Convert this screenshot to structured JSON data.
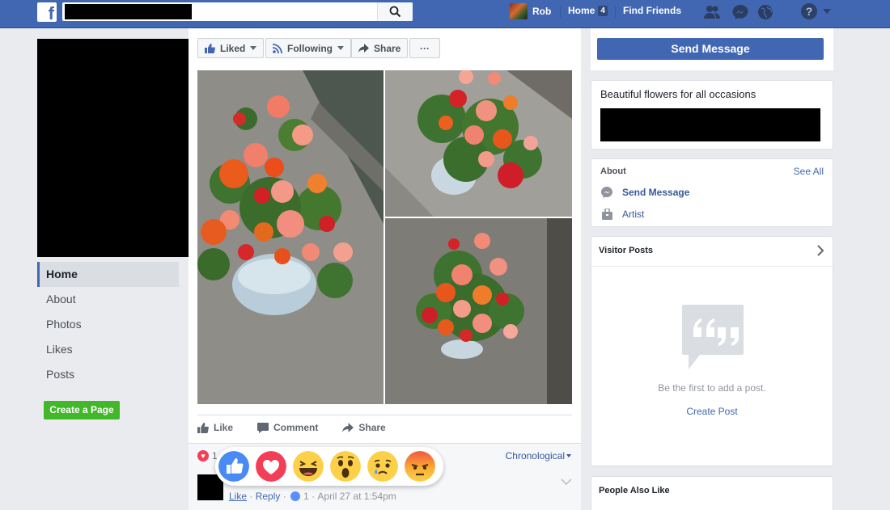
{
  "topbar": {
    "logo": "f",
    "search_placeholder": "",
    "user_name": "Rob",
    "home_label": "Home",
    "home_badge": "4",
    "find_friends_label": "Find Friends",
    "help_label": "?",
    "icons": [
      "friend-requests-icon",
      "messenger-icon",
      "notifications-globe-icon",
      "help-icon",
      "account-menu-caret-icon"
    ]
  },
  "left_nav": {
    "items": [
      {
        "label": "Home",
        "active": true
      },
      {
        "label": "About"
      },
      {
        "label": "Photos"
      },
      {
        "label": "Likes"
      },
      {
        "label": "Posts"
      }
    ],
    "create_page_label": "Create a Page"
  },
  "page_actions": {
    "liked_label": "Liked",
    "following_label": "Following",
    "share_label": "Share",
    "more_label": "···"
  },
  "post": {
    "actions": {
      "like_label": "Like",
      "comment_label": "Comment",
      "share_label": "Share"
    },
    "reaction_count": "1",
    "sort_label": "Chronological",
    "reactions": [
      "like",
      "love",
      "haha",
      "wow",
      "sad",
      "angry"
    ],
    "comment": {
      "like_label": "Like",
      "reply_label": "Reply",
      "like_count": "1",
      "timestamp": "April 27 at 1:54pm"
    }
  },
  "sidebar": {
    "send_message_label": "Send Message",
    "description": "Beautiful flowers for all occasions",
    "about": {
      "title": "About",
      "see_all_label": "See All",
      "send_message_label": "Send Message",
      "category": "Artist"
    },
    "visitor_posts": {
      "title": "Visitor Posts",
      "empty_text": "Be the first to add a post.",
      "create_label": "Create Post"
    },
    "people_also_like": {
      "title": "People Also Like"
    }
  },
  "colors": {
    "brand": "#4267b2",
    "background": "#e9ebee",
    "create_page_green": "#42b72a",
    "love_red": "#f33e58"
  }
}
